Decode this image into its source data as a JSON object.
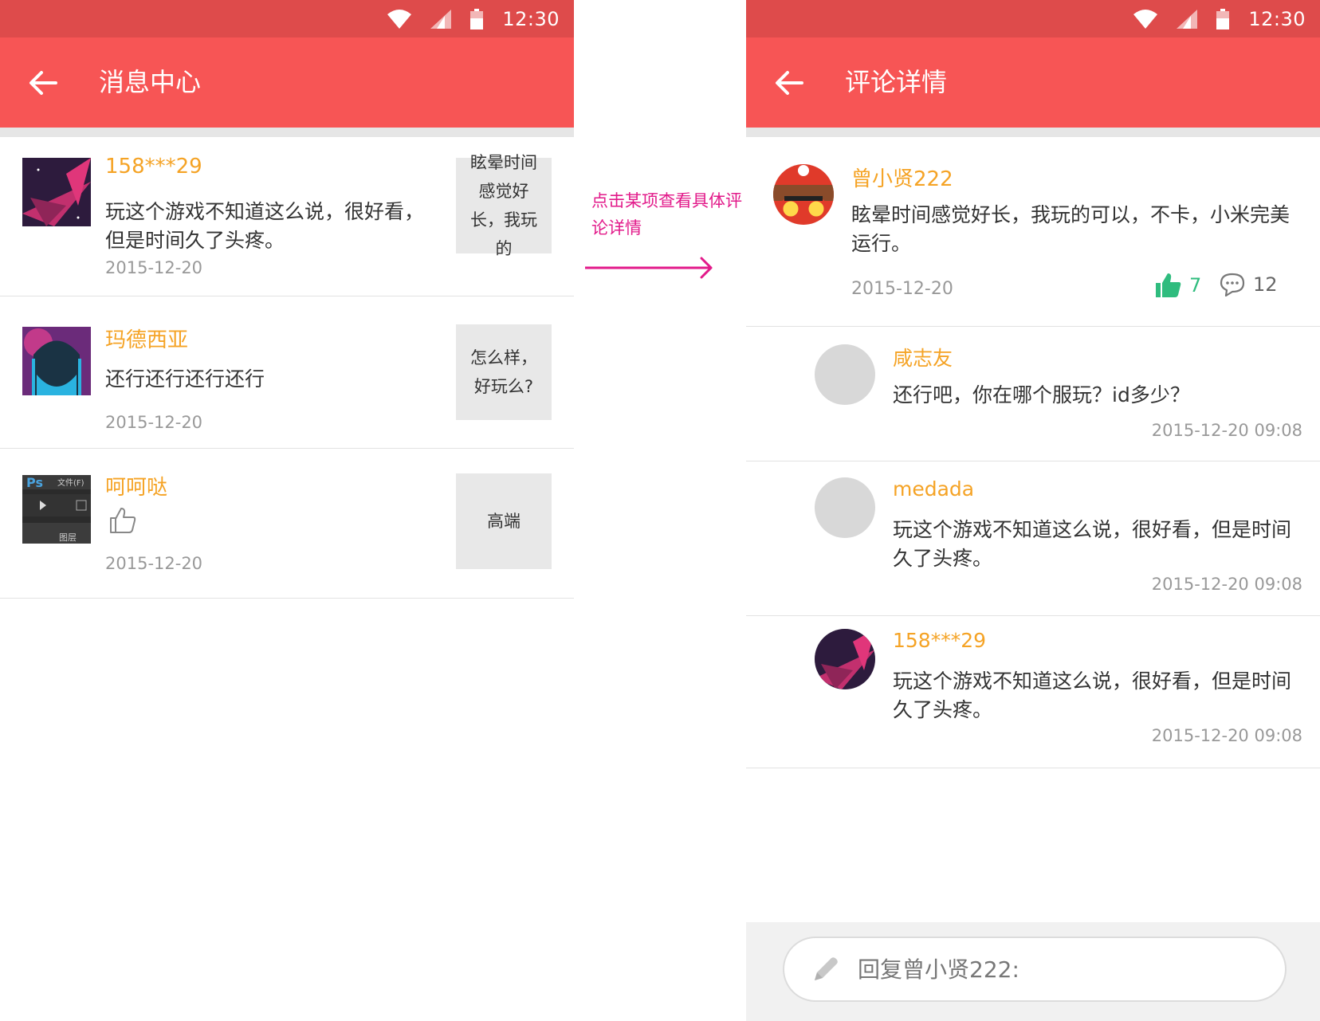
{
  "status_bar": {
    "time": "12:30",
    "icons": [
      "wifi-icon",
      "signal-icon",
      "battery-icon"
    ]
  },
  "left_screen": {
    "title": "消息中心",
    "messages": [
      {
        "user": "158***29",
        "text": "玩这个游戏不知道这么说，很好看，但是时间久了头疼。",
        "date": "2015-12-20",
        "quote": "眩晕时间感觉好长，我玩的"
      },
      {
        "user": "玛德西亚",
        "text": "还行还行还行还行",
        "date": "2015-12-20",
        "quote": "怎么样，好玩么?"
      },
      {
        "user": "呵呵哒",
        "text": "",
        "date": "2015-12-20",
        "quote": "高端",
        "like_icon": "thumbs-up-outline-icon"
      }
    ],
    "thumb_ps": {
      "logo": "Ps",
      "menu": "文件(F)",
      "layers": "图层"
    }
  },
  "annotation": {
    "text": "点击某项查看具体评论详情",
    "color": "#e21a8a"
  },
  "right_screen": {
    "title": "评论详情",
    "main_comment": {
      "user": "曾小贤222",
      "text": "眩晕时间感觉好长，我玩的可以，不卡，小米完美运行。",
      "date": "2015-12-20",
      "likes": "7",
      "replies": "12"
    },
    "replies": [
      {
        "user": "咸志友",
        "text": "还行吧，你在哪个服玩？id多少？",
        "date": "2015-12-20  09:08"
      },
      {
        "user": "medada",
        "text": "玩这个游戏不知道这么说，很好看，但是时间久了头疼。",
        "date": "2015-12-20  09:08"
      },
      {
        "user": "158***29",
        "text": "玩这个游戏不知道这么说，很好看，但是时间久了头疼。",
        "date": "2015-12-20  09:08"
      }
    ],
    "reply_input": {
      "placeholder": "回复曾小贤222:"
    }
  },
  "colors": {
    "status_bar": "#de4b4b",
    "app_bar": "#f75555",
    "username": "#f5a325",
    "like_green": "#2fbc7e",
    "annotation": "#e21a8a"
  }
}
